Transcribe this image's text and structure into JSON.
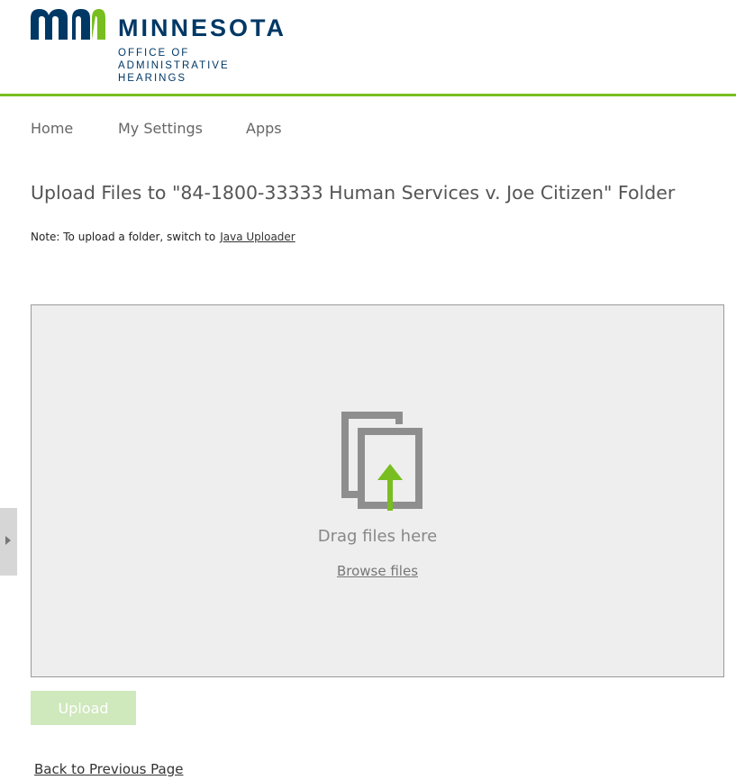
{
  "header": {
    "brand_title": "MINNESOTA",
    "brand_sub_lines": [
      "OFFICE OF",
      "ADMINISTRATIVE",
      "HEARINGS"
    ],
    "brand_color": "#003865",
    "accent_color": "#78be21"
  },
  "nav": {
    "items": [
      {
        "label": "Home"
      },
      {
        "label": "My Settings"
      },
      {
        "label": "Apps"
      }
    ]
  },
  "main": {
    "title": "Upload Files to \"84-1800-33333 Human Services v. Joe Citizen\" Folder",
    "note_prefix": "Note: To upload a folder, switch to",
    "note_link": "Java Uploader",
    "dropzone": {
      "icon": "files-upload-icon",
      "drag_text": "Drag files here",
      "browse_label": "Browse files"
    },
    "upload_button": "Upload",
    "back_link": "Back to Previous Page"
  },
  "side_panel": {
    "icon": "chevron-right-icon"
  }
}
